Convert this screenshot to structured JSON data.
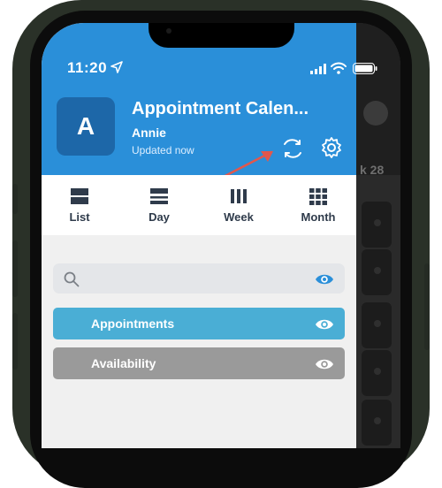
{
  "status": {
    "time": "11:20"
  },
  "header": {
    "avatar_letter": "A",
    "title": "Appointment Calen...",
    "user": "Annie",
    "updated": "Updated now"
  },
  "views": [
    {
      "label": "List",
      "icon": "list-icon"
    },
    {
      "label": "Day",
      "icon": "day-icon"
    },
    {
      "label": "Week",
      "icon": "week-icon"
    },
    {
      "label": "Month",
      "icon": "month-icon"
    }
  ],
  "search": {
    "placeholder": "",
    "value": ""
  },
  "calendars": [
    {
      "label": "Appointments",
      "color": "#4aaed5"
    },
    {
      "label": "Availability",
      "color": "#9a9a9a"
    }
  ],
  "background_app": {
    "label": "k 28"
  },
  "colors": {
    "header": "#2a8fd9",
    "eye_accent": "#2a8fd9",
    "annotation_arrow": "#e2574c"
  }
}
